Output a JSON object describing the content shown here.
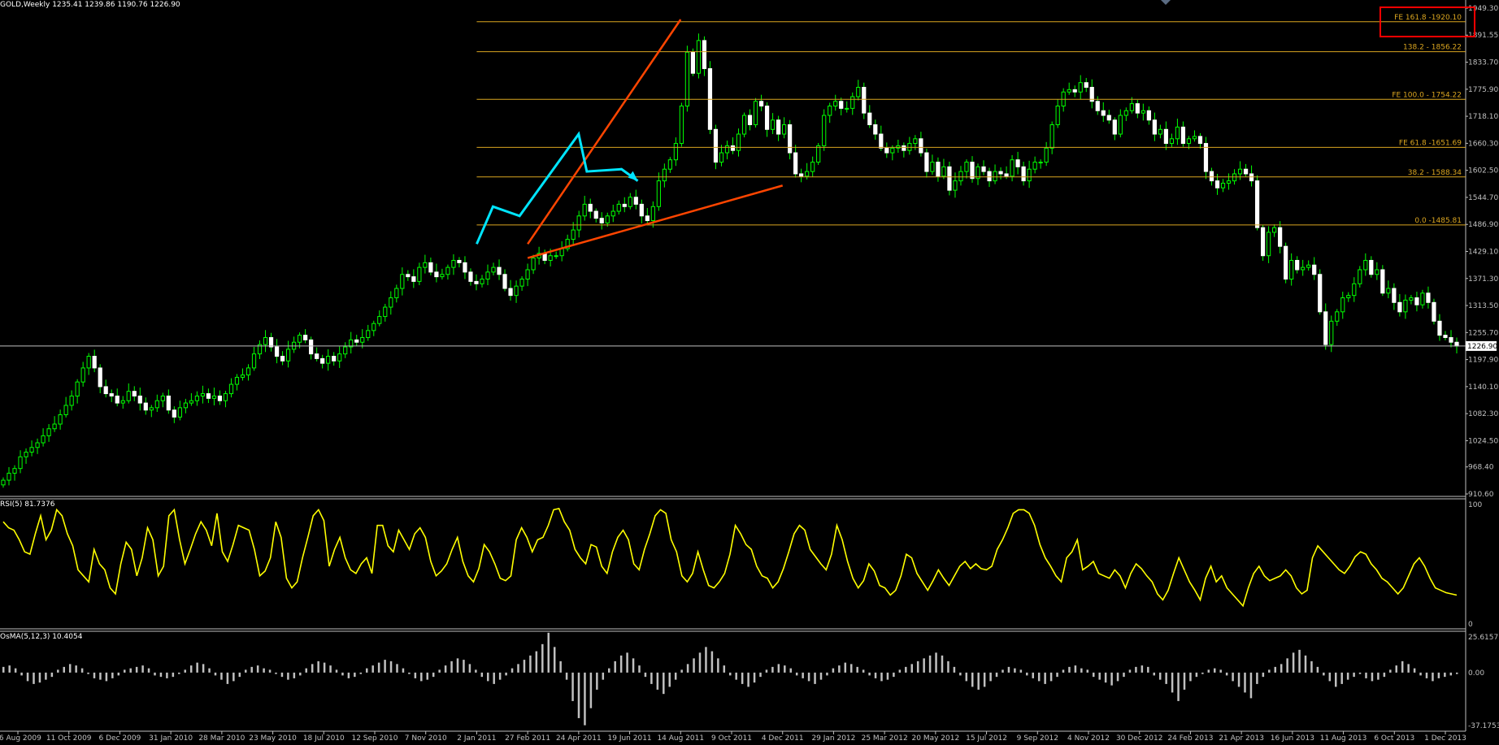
{
  "header": {
    "symbol_line": "GOLD,Weekly  1235.41 1239.86 1190.76 1226.90",
    "rsi_label": "RSI(5) 81.7376",
    "osma_label": "OsMA(5,12,3) 10.4054"
  },
  "colors": {
    "background": "#000000",
    "axis": "#c0c0c0",
    "candle_bull_fill": "#000000",
    "candle_bull_outline": "#00ff00",
    "candle_bear": "#ffffff",
    "wick": "#00ff00",
    "fib_line": "#daa520",
    "fib_text": "#daa520",
    "trend_orange": "#ff4500",
    "wave_cyan": "#00e5ff",
    "rsi_line": "#ffff00",
    "osma_bar": "#c0c0c0",
    "current_price_line": "#c0c0c0",
    "highlight_box": "#ff0000"
  },
  "chart_data": [
    {
      "type": "candlestick",
      "title": "GOLD,Weekly",
      "ohlc_header": {
        "open": 1235.41,
        "high": 1239.86,
        "low": 1190.76,
        "close": 1226.9
      },
      "ylim": [
        910.6,
        1949.3
      ],
      "price_axis_ticks": [
        "1949.30",
        "1891.55",
        "1833.70",
        "1775.90",
        "1718.10",
        "1660.30",
        "1602.50",
        "1544.70",
        "1486.90",
        "1429.10",
        "1371.30",
        "1313.50",
        "1255.70",
        "1197.90",
        "1140.10",
        "1082.30",
        "1024.50",
        "968.40",
        "910.60"
      ],
      "current_price": "1226.90",
      "x_tick_labels": [
        "16 Aug 2009",
        "11 Oct 2009",
        "6 Dec 2009",
        "31 Jan 2010",
        "28 Mar 2010",
        "23 May 2010",
        "18 Jul 2010",
        "12 Sep 2010",
        "7 Nov 2010",
        "2 Jan 2011",
        "27 Feb 2011",
        "24 Apr 2011",
        "19 Jun 2011",
        "14 Aug 2011",
        "9 Oct 2011",
        "4 Dec 2011",
        "29 Jan 2012",
        "25 Mar 2012",
        "20 May 2012",
        "15 Jul 2012",
        "9 Sep 2012",
        "4 Nov 2012",
        "30 Dec 2012",
        "24 Feb 2013",
        "21 Apr 2013",
        "16 Jun 2013",
        "11 Aug 2013",
        "6 Oct 2013",
        "1 Dec 2013"
      ],
      "weekly_close": [
        940,
        955,
        965,
        990,
        1000,
        1010,
        1020,
        1035,
        1050,
        1060,
        1080,
        1100,
        1120,
        1150,
        1180,
        1205,
        1180,
        1140,
        1125,
        1120,
        1105,
        1110,
        1130,
        1120,
        1105,
        1090,
        1095,
        1110,
        1120,
        1090,
        1075,
        1095,
        1105,
        1110,
        1120,
        1125,
        1115,
        1120,
        1110,
        1125,
        1145,
        1160,
        1165,
        1180,
        1210,
        1230,
        1245,
        1225,
        1205,
        1195,
        1220,
        1235,
        1250,
        1240,
        1210,
        1200,
        1190,
        1205,
        1195,
        1210,
        1225,
        1240,
        1235,
        1245,
        1260,
        1275,
        1290,
        1310,
        1330,
        1350,
        1380,
        1375,
        1365,
        1395,
        1405,
        1385,
        1375,
        1380,
        1395,
        1410,
        1405,
        1385,
        1365,
        1360,
        1370,
        1385,
        1395,
        1380,
        1350,
        1335,
        1355,
        1370,
        1390,
        1415,
        1425,
        1410,
        1420,
        1420,
        1435,
        1455,
        1475,
        1505,
        1530,
        1515,
        1500,
        1490,
        1505,
        1515,
        1530,
        1525,
        1545,
        1530,
        1505,
        1495,
        1525,
        1580,
        1605,
        1625,
        1660,
        1740,
        1855,
        1810,
        1880,
        1820,
        1690,
        1620,
        1640,
        1655,
        1645,
        1680,
        1720,
        1700,
        1750,
        1740,
        1690,
        1710,
        1680,
        1700,
        1640,
        1595,
        1590,
        1600,
        1620,
        1655,
        1720,
        1740,
        1750,
        1735,
        1735,
        1760,
        1780,
        1725,
        1700,
        1680,
        1650,
        1640,
        1650,
        1655,
        1645,
        1660,
        1670,
        1640,
        1600,
        1620,
        1590,
        1610,
        1560,
        1580,
        1600,
        1620,
        1585,
        1610,
        1600,
        1580,
        1600,
        1595,
        1590,
        1625,
        1610,
        1580,
        1605,
        1620,
        1620,
        1650,
        1700,
        1740,
        1770,
        1775,
        1770,
        1790,
        1780,
        1750,
        1730,
        1720,
        1710,
        1680,
        1720,
        1730,
        1745,
        1725,
        1730,
        1710,
        1680,
        1690,
        1660,
        1670,
        1695,
        1660,
        1670,
        1675,
        1660,
        1600,
        1580,
        1565,
        1575,
        1580,
        1595,
        1605,
        1595,
        1580,
        1480,
        1420,
        1470,
        1480,
        1440,
        1370,
        1410,
        1390,
        1395,
        1400,
        1380,
        1300,
        1230,
        1280,
        1300,
        1330,
        1335,
        1360,
        1390,
        1410,
        1380,
        1390,
        1340,
        1350,
        1320,
        1300,
        1325,
        1330,
        1315,
        1340,
        1320,
        1280,
        1250,
        1245,
        1235,
        1227
      ],
      "annotations": {
        "fibonacci_levels": [
          {
            "label": "FE 161.8 -1920.10",
            "price": 1920.1
          },
          {
            "label": "138.2 - 1856.22",
            "price": 1856.22
          },
          {
            "label": "FE 100.0 - 1754.22",
            "price": 1754.22
          },
          {
            "label": "FE 61.8 -1651.69",
            "price": 1651.69
          },
          {
            "label": "38.2 - 1588.34",
            "price": 1588.34
          },
          {
            "label": "0.0 -1485.81",
            "price": 1485.81
          }
        ],
        "fib_line_start_date": "2 Jan 2011",
        "orange_trend_lines": [
          {
            "from": {
              "date": "27 Feb 2011",
              "price": 1445
            },
            "to": {
              "date": "14 Aug 2011",
              "price": 1925
            }
          },
          {
            "from": {
              "date": "27 Feb 2011",
              "price": 1415
            },
            "to": {
              "date": "4 Dec 2011",
              "price": 1570
            }
          }
        ],
        "cyan_wave_path": [
          {
            "date": "2 Jan 2011",
            "price": 1445
          },
          {
            "date": "2 Jan 2011",
            "price": 1525
          },
          {
            "date": "27 Feb 2011",
            "price": 1505
          },
          {
            "date": "24 Apr 2011",
            "price": 1680
          },
          {
            "date": "24 Apr 2011",
            "price": 1600
          },
          {
            "date": "19 Jun 2011",
            "price": 1605
          },
          {
            "date": "19 Jun 2011",
            "price": 1580
          }
        ]
      }
    },
    {
      "type": "line",
      "title": "RSI(5) 81.7376",
      "ylim": [
        0,
        100
      ],
      "y_ticks": [
        "100",
        "0"
      ],
      "values": [
        85,
        80,
        78,
        70,
        60,
        58,
        75,
        90,
        70,
        78,
        95,
        90,
        75,
        65,
        45,
        40,
        35,
        62,
        50,
        45,
        30,
        25,
        50,
        68,
        62,
        40,
        55,
        80,
        70,
        40,
        48,
        90,
        95,
        70,
        50,
        62,
        75,
        85,
        78,
        65,
        92,
        60,
        52,
        66,
        82,
        80,
        78,
        62,
        40,
        44,
        55,
        85,
        72,
        38,
        30,
        35,
        55,
        72,
        90,
        95,
        86,
        48,
        62,
        72,
        55,
        45,
        42,
        50,
        55,
        42,
        82,
        82,
        65,
        60,
        78,
        70,
        62,
        75,
        80,
        72,
        52,
        40,
        44,
        50,
        62,
        72,
        52,
        40,
        35,
        46,
        66,
        60,
        50,
        38,
        36,
        40,
        70,
        80,
        72,
        60,
        70,
        72,
        82,
        95,
        96,
        85,
        78,
        62,
        55,
        50,
        66,
        64,
        48,
        42,
        60,
        72,
        78,
        70,
        50,
        45,
        62,
        75,
        90,
        95,
        92,
        70,
        60,
        40,
        35,
        42,
        60,
        45,
        32,
        30,
        35,
        42,
        58,
        82,
        75,
        66,
        62,
        48,
        40,
        38,
        30,
        35,
        46,
        60,
        75,
        82,
        78,
        62,
        56,
        50,
        45,
        58,
        82,
        70,
        52,
        38,
        30,
        36,
        50,
        44,
        32,
        30,
        24,
        28,
        40,
        58,
        55,
        42,
        35,
        28,
        36,
        45,
        38,
        32,
        40,
        48,
        52,
        46,
        50,
        46,
        45,
        48,
        62,
        70,
        80,
        92,
        95,
        95,
        92,
        82,
        66,
        55,
        48,
        40,
        35,
        55,
        60,
        70,
        45,
        48,
        52,
        42,
        40,
        38,
        45,
        40,
        30,
        42,
        50,
        46,
        40,
        35,
        25,
        20,
        28,
        42,
        55,
        45,
        35,
        28,
        20,
        38,
        48,
        35,
        40,
        30,
        25,
        20,
        15,
        30,
        42,
        48,
        40,
        36,
        38,
        40,
        45,
        40,
        30,
        25,
        28,
        55,
        65,
        60,
        55,
        50,
        45,
        42,
        48,
        56,
        60,
        58,
        50,
        45,
        38,
        35,
        30,
        25,
        30,
        40,
        50,
        55,
        48,
        38,
        30,
        28,
        26,
        25,
        24
      ]
    },
    {
      "type": "bar",
      "title": "OsMA(5,12,3) 10.4054",
      "ylim": [
        -37.1753,
        25.6157
      ],
      "y_ticks": [
        "25.6157",
        "0.00",
        "-37.1753"
      ],
      "values": [
        4,
        5,
        3,
        -2,
        -6,
        -8,
        -7,
        -5,
        -3,
        2,
        4,
        6,
        5,
        3,
        -1,
        -4,
        -5,
        -6,
        -4,
        -2,
        2,
        3,
        4,
        5,
        3,
        -2,
        -3,
        -4,
        -3,
        -1,
        2,
        5,
        7,
        6,
        3,
        -2,
        -5,
        -8,
        -6,
        -3,
        2,
        4,
        5,
        3,
        2,
        -1,
        -3,
        -5,
        -4,
        -2,
        3,
        6,
        8,
        7,
        5,
        2,
        -2,
        -4,
        -3,
        -1,
        3,
        5,
        7,
        9,
        8,
        6,
        3,
        -1,
        -4,
        -6,
        -5,
        -3,
        2,
        5,
        8,
        10,
        9,
        6,
        2,
        -3,
        -6,
        -8,
        -5,
        -2,
        3,
        6,
        9,
        12,
        15,
        20,
        28,
        18,
        8,
        -5,
        -20,
        -32,
        -37,
        -25,
        -12,
        -5,
        3,
        8,
        12,
        14,
        10,
        5,
        -3,
        -8,
        -12,
        -15,
        -10,
        -5,
        2,
        6,
        10,
        14,
        18,
        15,
        10,
        5,
        -2,
        -5,
        -8,
        -10,
        -7,
        -3,
        2,
        4,
        6,
        5,
        3,
        -2,
        -4,
        -6,
        -8,
        -5,
        -2,
        3,
        5,
        7,
        6,
        4,
        2,
        -2,
        -4,
        -6,
        -5,
        -3,
        2,
        4,
        6,
        8,
        10,
        12,
        14,
        12,
        8,
        4,
        -2,
        -6,
        -10,
        -12,
        -10,
        -6,
        -3,
        2,
        4,
        3,
        2,
        -2,
        -4,
        -6,
        -8,
        -6,
        -3,
        2,
        4,
        5,
        3,
        2,
        -3,
        -5,
        -7,
        -9,
        -6,
        -3,
        2,
        4,
        5,
        4,
        -2,
        -5,
        -8,
        -14,
        -20,
        -12,
        -6,
        -3,
        -1,
        2,
        3,
        2,
        -2,
        -6,
        -10,
        -14,
        -18,
        -8,
        -3,
        2,
        4,
        6,
        10,
        14,
        16,
        12,
        8,
        4,
        -2,
        -6,
        -10,
        -8,
        -5,
        -3,
        -1,
        -4,
        -6,
        -5,
        -3,
        2,
        5,
        8,
        6,
        3,
        -2,
        -4,
        -6,
        -4,
        -3,
        -2,
        -1
      ]
    }
  ]
}
